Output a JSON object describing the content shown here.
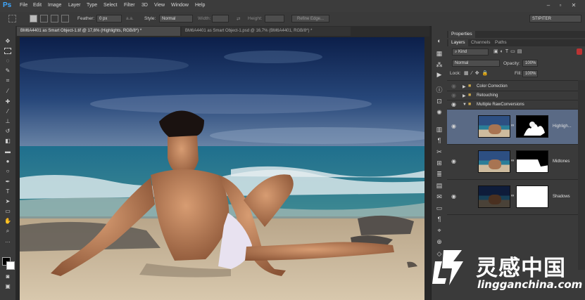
{
  "menubar": {
    "logo": "Ps",
    "items": [
      "File",
      "Edit",
      "Image",
      "Layer",
      "Type",
      "Select",
      "Filter",
      "3D",
      "View",
      "Window",
      "Help"
    ]
  },
  "options_bar": {
    "feather_label": "Feather:",
    "feather_value": "0 px",
    "antialias_label": "a.a.",
    "style_label": "Style:",
    "style_value": "Normal",
    "width_label": "Width:",
    "height_label": "Height:",
    "refine_edge": "Refine Edge...",
    "workspace": "STIPITER"
  },
  "document_tabs": [
    {
      "label": "BM6A4401 as Smart Object-1.tif @ 17,6% (Highlights, RGB/8*) *",
      "active": true
    },
    {
      "label": "BM6A4401 as Smart Object-1.psd @ 16,7% (BM6A4401, RGB/8*) *",
      "active": false
    }
  ],
  "panels": {
    "properties_tab": "Properties",
    "layers_tab": "Layers",
    "channels_tab": "Channels",
    "paths_tab": "Paths",
    "filter_kind": "Kind",
    "blend_mode": "Normal",
    "opacity_label": "Opacity:",
    "opacity_value": "100%",
    "lock_label": "Lock:",
    "fill_label": "Fill:",
    "fill_value": "100%",
    "groups": [
      "Color Correction",
      "Retouching",
      "Multiple RawConversions"
    ],
    "layers": [
      {
        "name": "Highligh...",
        "selected": true
      },
      {
        "name": "Midtones",
        "selected": false
      },
      {
        "name": "Shadows",
        "selected": false
      }
    ]
  },
  "watermark": {
    "chinese": "灵感中国",
    "url": "lingganchina.com"
  }
}
